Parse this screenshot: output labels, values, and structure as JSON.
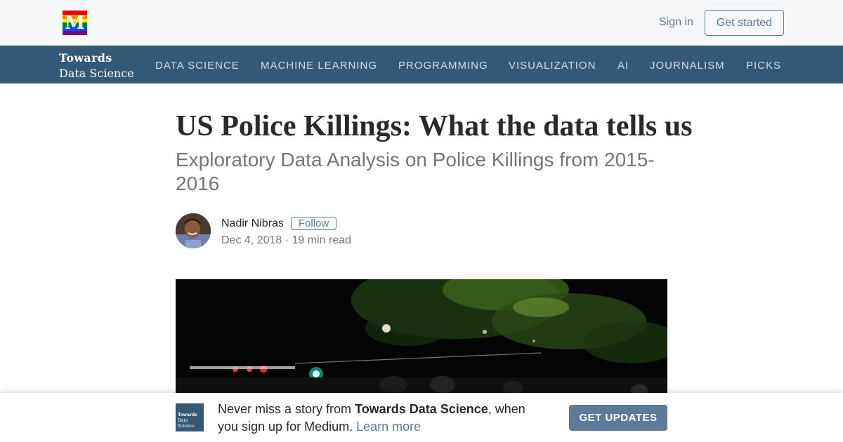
{
  "topbar": {
    "logo_letter": "M",
    "logo_icon": "medium-rainbow-logo",
    "logo_stripes": [
      "#e40303",
      "#ff8c00",
      "#ffed00",
      "#008026",
      "#004dff",
      "#750787"
    ],
    "sign_in": "Sign in",
    "get_started": "Get started"
  },
  "publication": {
    "name_line1": "Towards",
    "name_line2": "Data Science",
    "bar_color": "#355876",
    "nav": [
      {
        "label": "DATA SCIENCE"
      },
      {
        "label": "MACHINE LEARNING"
      },
      {
        "label": "PROGRAMMING"
      },
      {
        "label": "VISUALIZATION"
      },
      {
        "label": "AI"
      },
      {
        "label": "JOURNALISM"
      },
      {
        "label": "PICKS"
      }
    ]
  },
  "article": {
    "title": "US Police Killings: What the data tells us",
    "subtitle": "Exploratory Data Analysis on Police Killings from 2015-2016",
    "author": "Nadir Nibras",
    "follow": "Follow",
    "meta": "Dec 4, 2018 · 19 min read",
    "hero_image": "night-street-police-lights-photo"
  },
  "banner": {
    "logo_line1": "Towards",
    "logo_line2": "Data Science",
    "text_before": "Never miss a story from ",
    "text_bold": "Towards Data Science",
    "text_after": ", when you sign up for Medium. ",
    "learn_more": "Learn more",
    "cta": "GET UPDATES"
  },
  "colors": {
    "accent": "#5c7a99",
    "nav_bg": "#355876"
  }
}
